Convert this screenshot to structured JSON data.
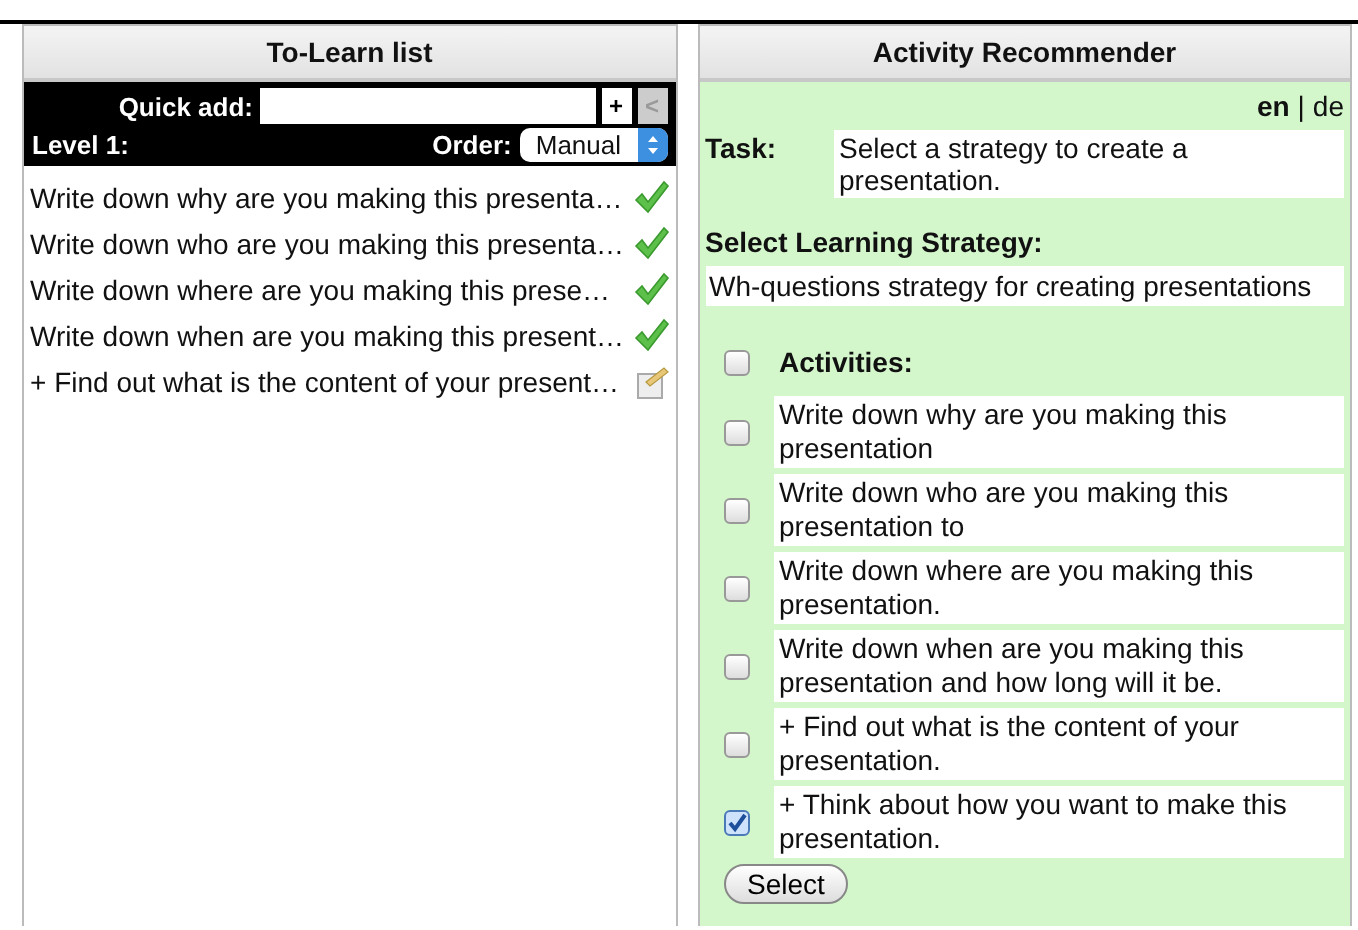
{
  "todo_panel": {
    "title": "To-Learn list",
    "quick_add": {
      "label": "Quick add:",
      "add_button": "+",
      "back_button": "<"
    },
    "level": "Level 1:",
    "order": {
      "label": "Order:",
      "value": "Manual"
    },
    "items": [
      {
        "text": "Write down why are you making this presenta…",
        "done": true
      },
      {
        "text": "Write down who are you making this presenta…",
        "done": true
      },
      {
        "text": "Write down where are you making this prese…",
        "done": true
      },
      {
        "text": "Write down when are you making this present…",
        "done": true
      },
      {
        "text": "+ Find out what is the content of your present…",
        "done": false
      }
    ]
  },
  "recommender_panel": {
    "title": "Activity Recommender",
    "language_separator": "|",
    "languages": [
      {
        "label": "en",
        "selected": true
      },
      {
        "label": "de",
        "selected": false
      }
    ],
    "task": {
      "label": "Task:",
      "value": "Select a strategy to create a presentation."
    },
    "strategy": {
      "label": "Select Learning Strategy:",
      "value": "Wh-questions strategy for creating presentations"
    },
    "activities_header": {
      "label": "Activities:",
      "checked": false
    },
    "activities": [
      {
        "text": "Write down why are you making this presentation",
        "checked": false
      },
      {
        "text": "Write down who are you making this presentation to",
        "checked": false
      },
      {
        "text": "Write down where are you making this presentation.",
        "checked": false
      },
      {
        "text": "Write down when are you making this presentation and how long will it be.",
        "checked": false
      },
      {
        "text": "+ Find out what is the content of your presentation.",
        "checked": false
      },
      {
        "text": "+ Think about how you want to make this presentation.",
        "checked": true
      }
    ],
    "select_button": "Select"
  }
}
